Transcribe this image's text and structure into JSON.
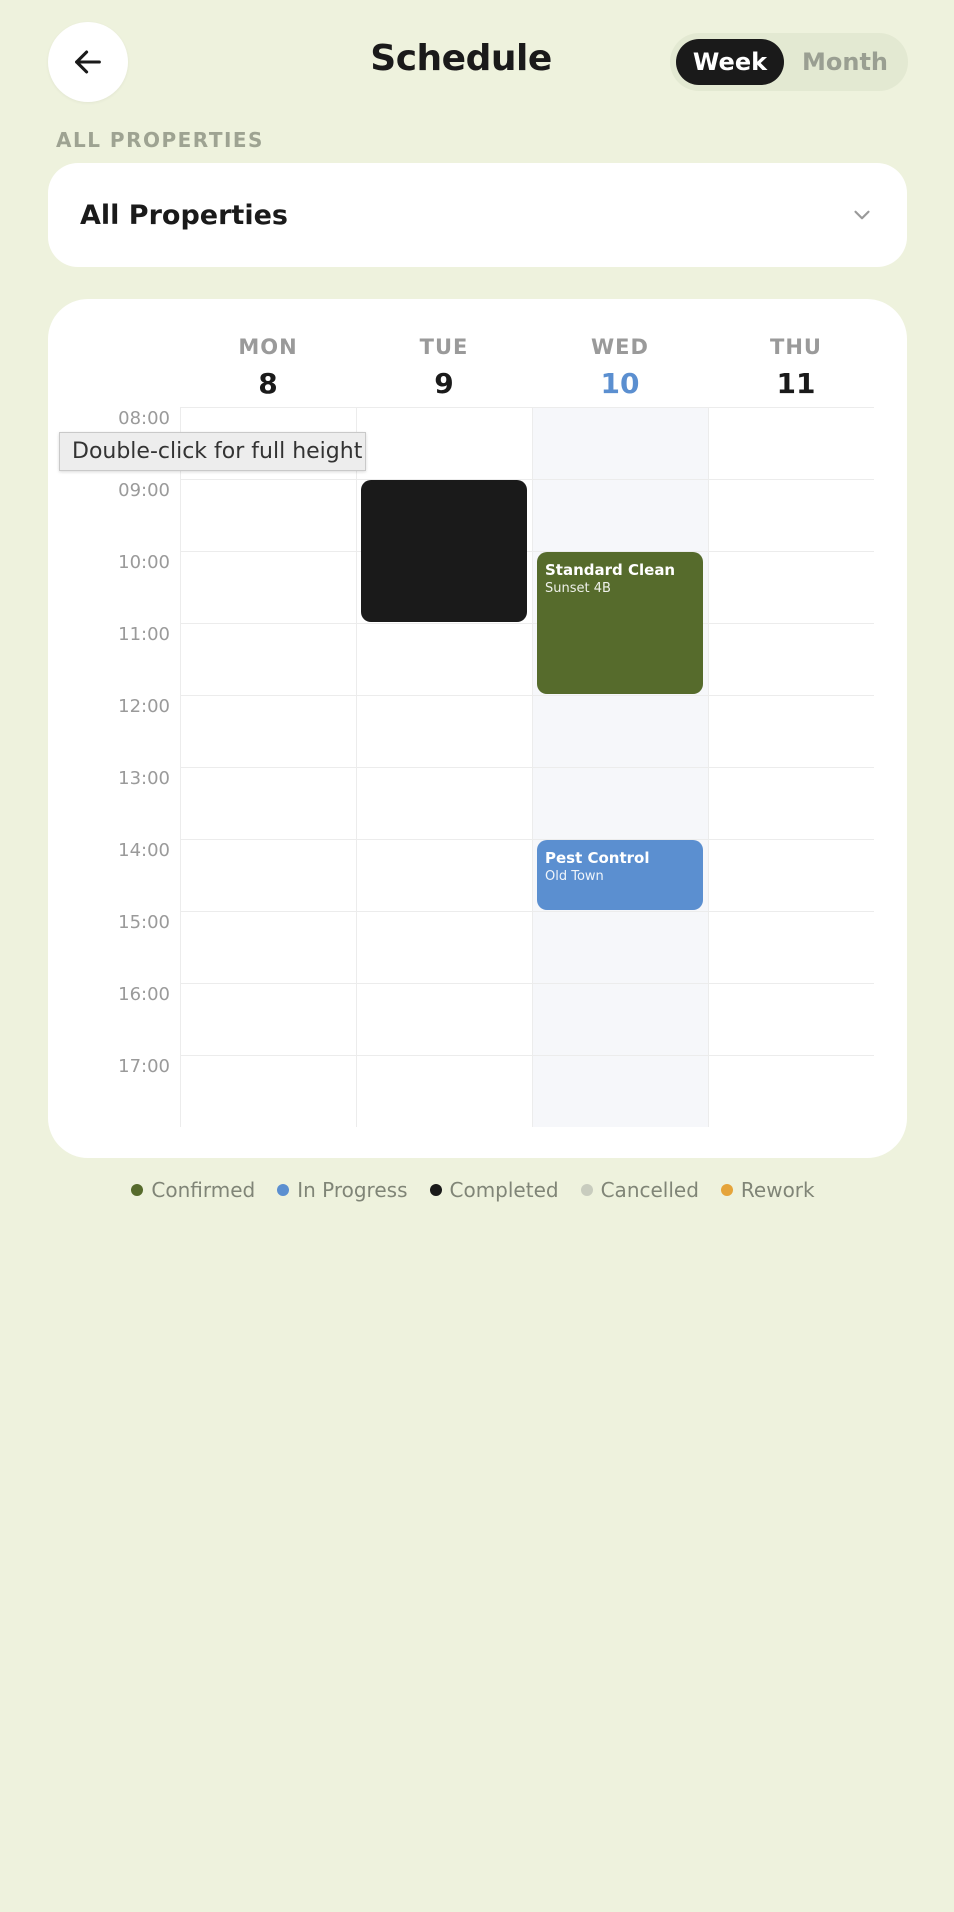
{
  "header": {
    "title": "Schedule",
    "view_toggle": {
      "week": "Week",
      "month": "Month",
      "selected": "Week"
    }
  },
  "filter": {
    "section_label": "ALL PROPERTIES",
    "selected": "All Properties"
  },
  "calendar": {
    "days": [
      {
        "name": "MON",
        "num": "8",
        "today": false
      },
      {
        "name": "TUE",
        "num": "9",
        "today": false
      },
      {
        "name": "WED",
        "num": "10",
        "today": true
      },
      {
        "name": "THU",
        "num": "11",
        "today": false
      }
    ],
    "hours": [
      "08:00",
      "09:00",
      "10:00",
      "11:00",
      "12:00",
      "13:00",
      "14:00",
      "15:00",
      "16:00",
      "17:00"
    ],
    "events": [
      {
        "day": 1,
        "start": "09:00",
        "end": "11:00",
        "title": "",
        "subtitle": "",
        "status": "Completed"
      },
      {
        "day": 2,
        "start": "10:00",
        "end": "12:00",
        "title": "Standard Clean",
        "subtitle": "Sunset 4B",
        "status": "Confirmed"
      },
      {
        "day": 2,
        "start": "14:00",
        "end": "15:00",
        "title": "Pest Control",
        "subtitle": "Old Town",
        "status": "In Progress"
      }
    ]
  },
  "tooltip": {
    "text": "Double-click for full height"
  },
  "legend": [
    {
      "label": "Confirmed",
      "color": "#566B2C"
    },
    {
      "label": "In Progress",
      "color": "#5B8FD0"
    },
    {
      "label": "Completed",
      "color": "#1A1A1A"
    },
    {
      "label": "Cancelled",
      "color": "#C8CCBE"
    },
    {
      "label": "Rework",
      "color": "#E5A43A"
    }
  ]
}
